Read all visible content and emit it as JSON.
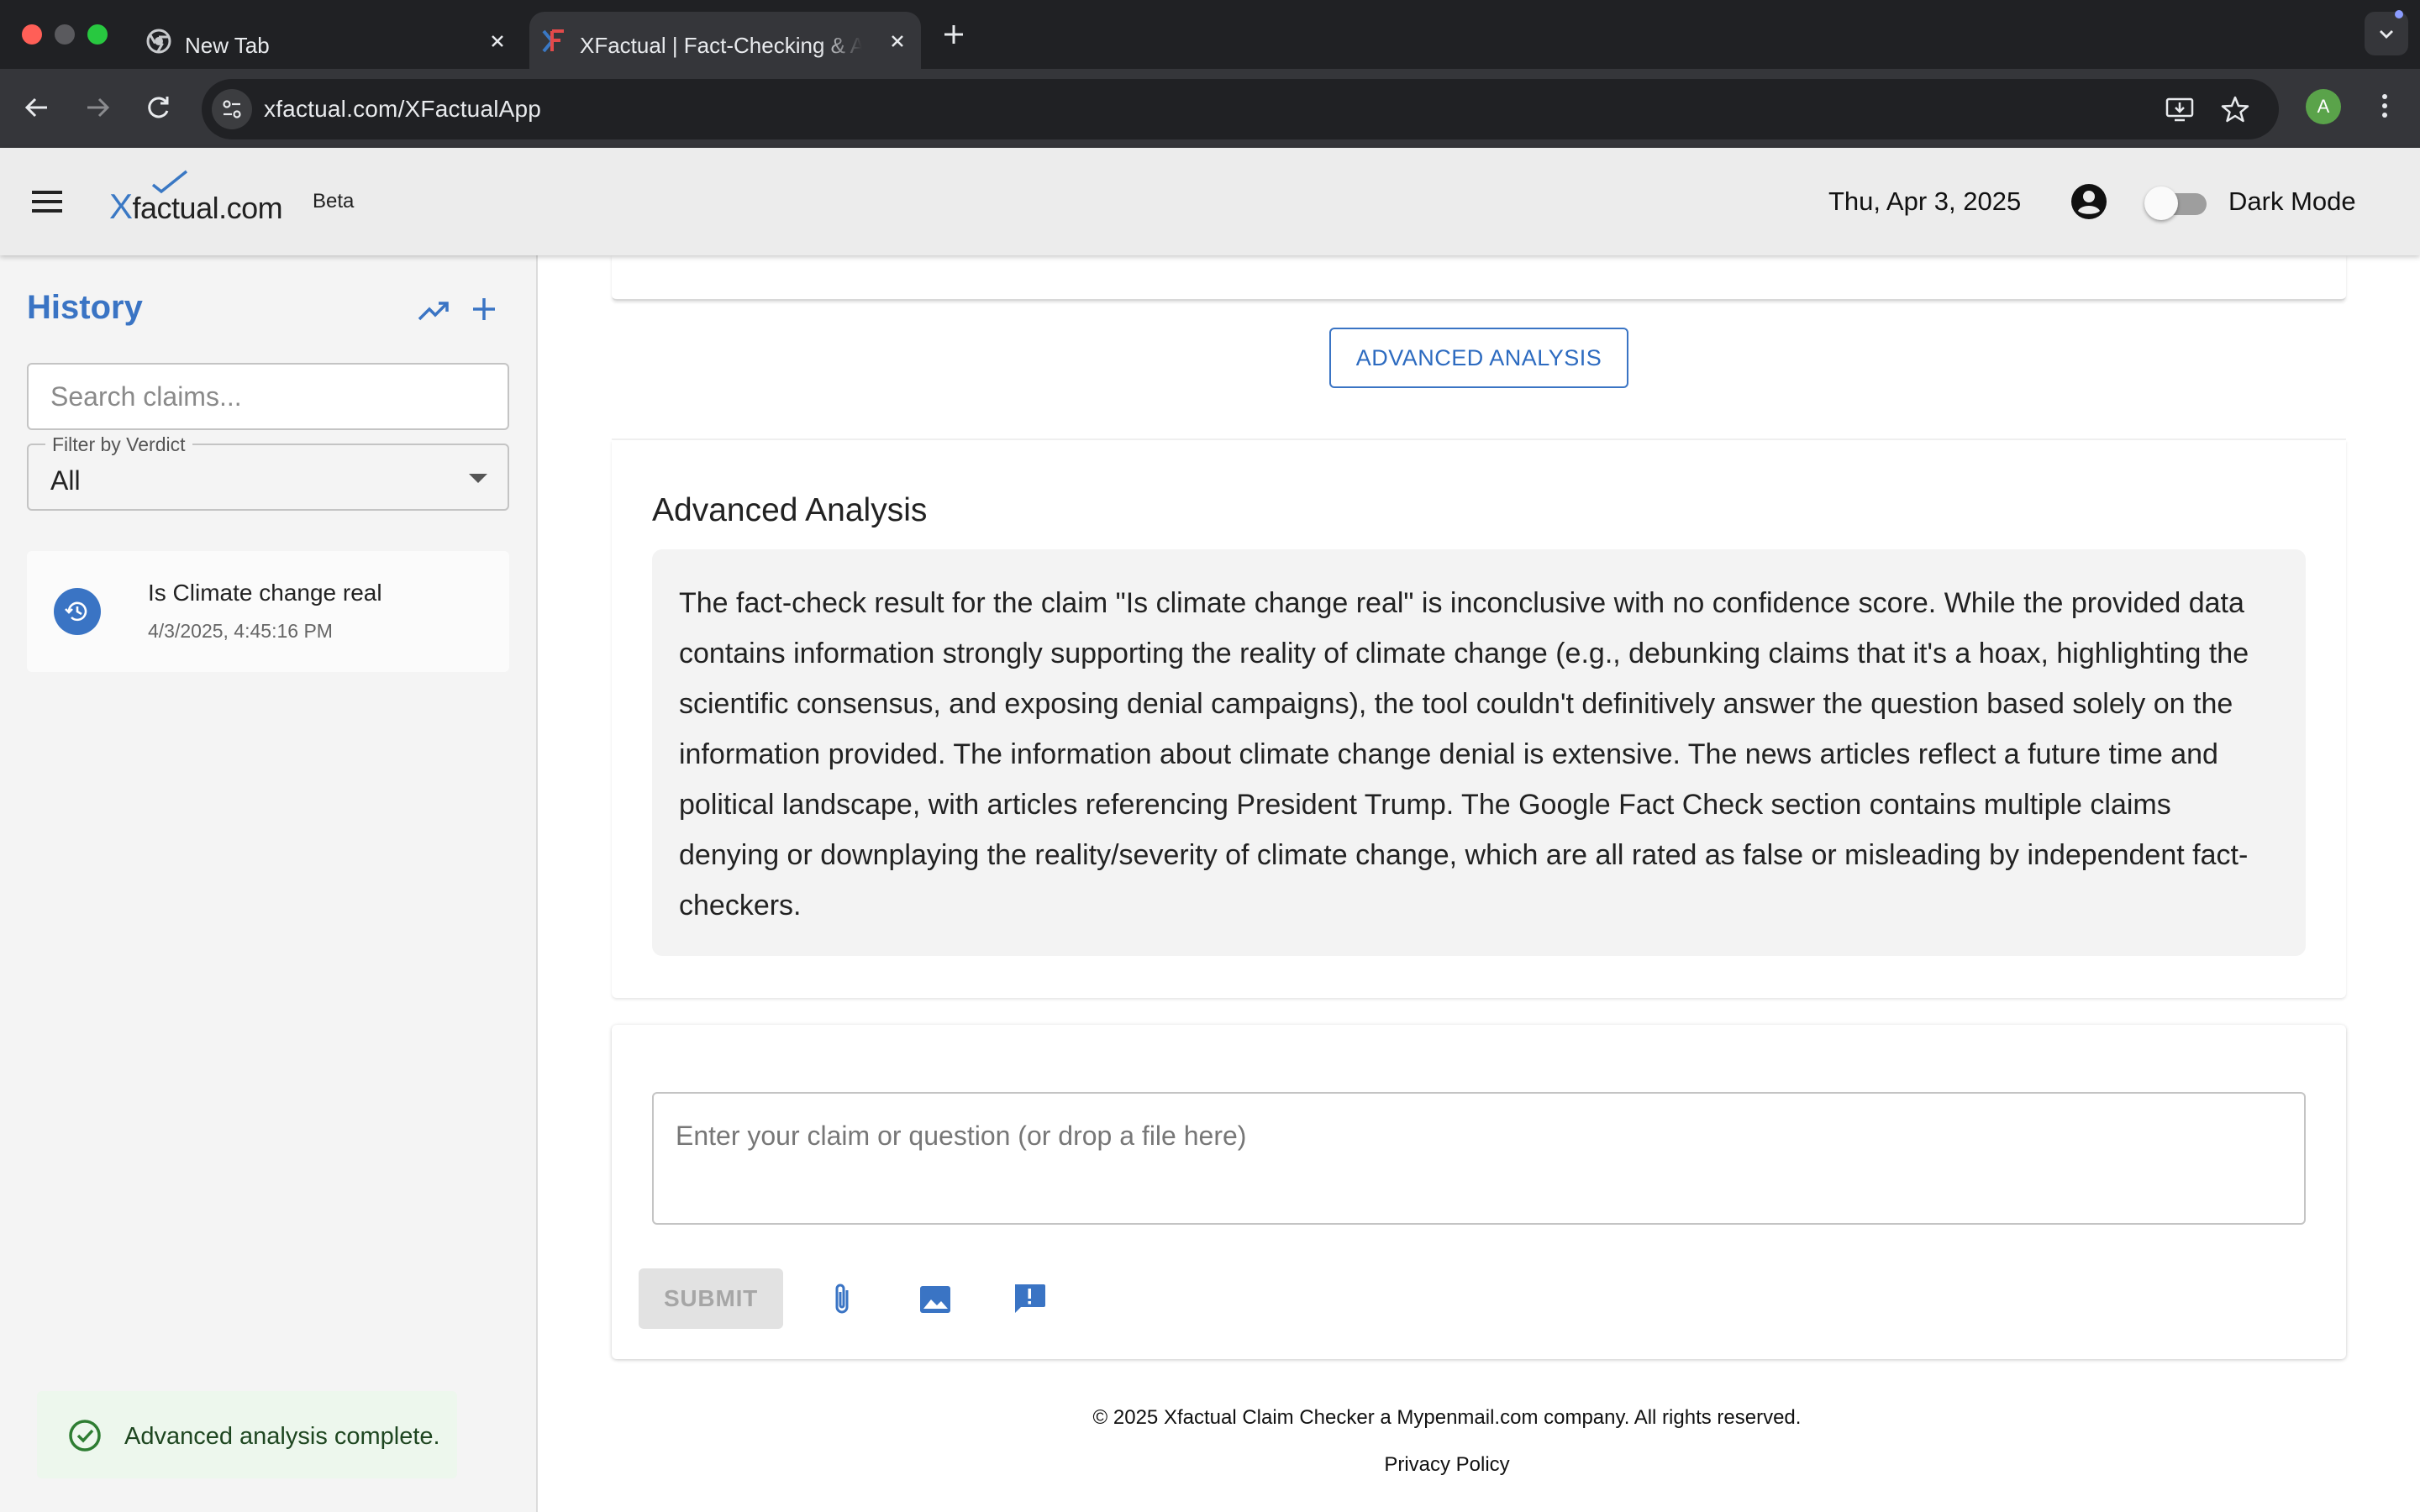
{
  "browser": {
    "tabs": [
      {
        "title": "New Tab",
        "active": false
      },
      {
        "title": "XFactual | Fact-Checking & Analysis",
        "active": true
      }
    ],
    "url": "xfactual.com/XFactualApp",
    "profile_initial": "A"
  },
  "header": {
    "logo_x": "X",
    "logo_rest": "factual.com",
    "beta": "Beta",
    "date": "Thu, Apr 3, 2025",
    "dark_mode_label": "Dark Mode",
    "dark_mode_on": false
  },
  "sidebar": {
    "title": "History",
    "search_placeholder": "Search claims...",
    "filter_label": "Filter by Verdict",
    "filter_value": "All",
    "items": [
      {
        "claim": "Is Climate change real",
        "timestamp": "4/3/2025, 4:45:16 PM"
      }
    ],
    "snackbar": "Advanced analysis complete."
  },
  "main": {
    "advanced_button": "ADVANCED ANALYSIS",
    "analysis_heading": "Advanced Analysis",
    "analysis_text": "The fact-check result for the claim \"Is climate change real\" is inconclusive with no confidence score. While the provided data contains information strongly supporting the reality of climate change (e.g., debunking claims that it's a hoax, highlighting the scientific consensus, and exposing denial campaigns), the tool couldn't definitively answer the question based solely on the information provided. The information about climate change denial is extensive. The news articles reflect a future time and political landscape, with articles referencing President Trump. The Google Fact Check section contains multiple claims denying or downplaying the reality/severity of climate change, which are all rated as false or misleading by independent fact-checkers.",
    "input_placeholder": "Enter your claim or question (or drop a file here)",
    "submit_label": "SUBMIT"
  },
  "footer": {
    "copyright": "© 2025 Xfactual Claim Checker a Mypenmail.com company. All rights reserved.",
    "privacy": "Privacy Policy"
  },
  "colors": {
    "accent": "#3a74c4",
    "success_bg": "#edf7ed",
    "success_icon": "#2e7d32"
  },
  "icons": [
    "chrome-icon",
    "xfactual-favicon",
    "close-icon",
    "plus-icon",
    "chevron-down-icon",
    "back-icon",
    "forward-icon",
    "reload-icon",
    "site-settings-icon",
    "install-icon",
    "star-icon",
    "kebab-icon",
    "menu-icon",
    "account-icon",
    "trending-up-icon",
    "history-icon",
    "check-circle-icon",
    "attach-icon",
    "image-icon",
    "feedback-icon"
  ]
}
